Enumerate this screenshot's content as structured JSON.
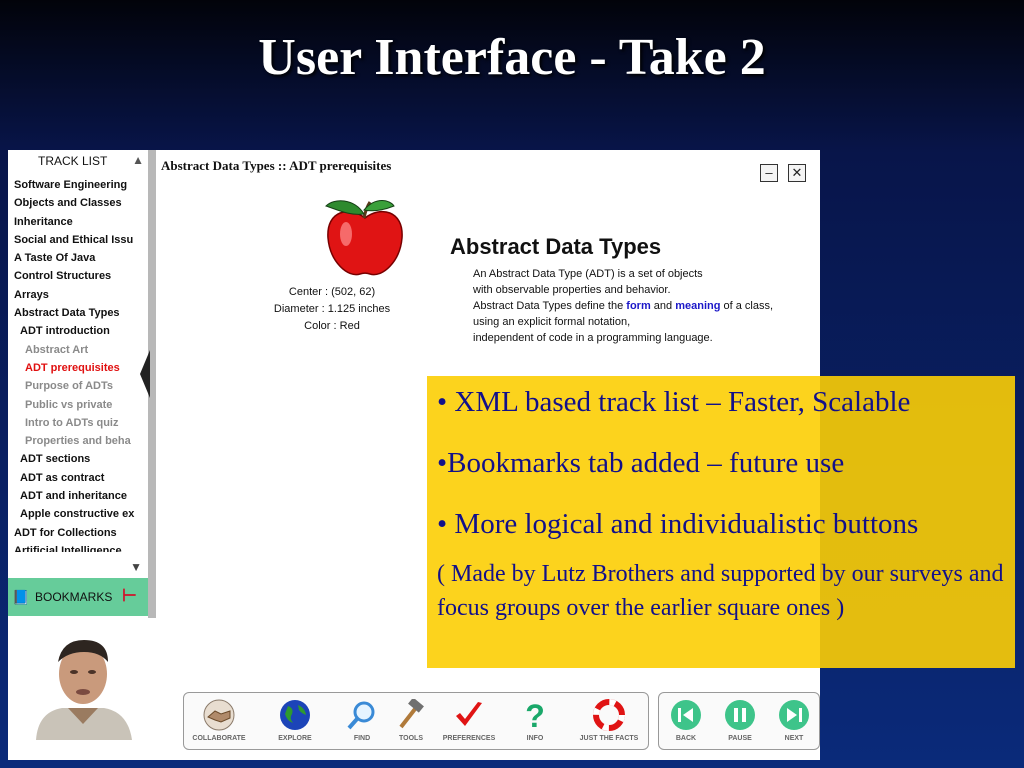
{
  "slide": {
    "title": "User Interface - Take 2"
  },
  "track_panel": {
    "header": "TRACK LIST",
    "items": [
      {
        "label": "Software Engineering",
        "level": 0,
        "active": false
      },
      {
        "label": "Objects and Classes",
        "level": 0,
        "active": false
      },
      {
        "label": "Inheritance",
        "level": 0,
        "active": false
      },
      {
        "label": "Social and Ethical Issu",
        "level": 0,
        "active": false
      },
      {
        "label": "A Taste Of Java",
        "level": 0,
        "active": false
      },
      {
        "label": "Control Structures",
        "level": 0,
        "active": false
      },
      {
        "label": "Arrays",
        "level": 0,
        "active": false
      },
      {
        "label": "Abstract Data Types",
        "level": 0,
        "active": false
      },
      {
        "label": "ADT introduction",
        "level": 1,
        "active": false
      },
      {
        "label": "Abstract Art",
        "level": 2,
        "active": false
      },
      {
        "label": "ADT prerequisites",
        "level": 2,
        "active": true
      },
      {
        "label": "Purpose of ADTs",
        "level": 2,
        "active": false
      },
      {
        "label": "Public vs private",
        "level": 2,
        "active": false
      },
      {
        "label": "Intro to ADTs quiz",
        "level": 2,
        "active": false
      },
      {
        "label": "Properties and beha",
        "level": 2,
        "active": false
      },
      {
        "label": "ADT sections",
        "level": 1,
        "active": false
      },
      {
        "label": "ADT as contract",
        "level": 1,
        "active": false
      },
      {
        "label": "ADT and inheritance",
        "level": 1,
        "active": false
      },
      {
        "label": "Apple constructive ex",
        "level": 1,
        "active": false
      },
      {
        "label": "ADT for Collections",
        "level": 0,
        "active": false
      },
      {
        "label": "Artificial Intelligence",
        "level": 0,
        "active": false
      }
    ],
    "bookmarks_label": "BOOKMARKS"
  },
  "content": {
    "breadcrumb": "Abstract Data Types :: ADT prerequisites",
    "minimize_glyph": "–",
    "close_glyph": "✕",
    "apple_info": {
      "center": "Center : (502, 62)",
      "diameter": "Diameter : 1.125 inches",
      "color": "Color : Red"
    },
    "heading": "Abstract Data Types",
    "para": {
      "line1": "An Abstract Data Type (ADT) is a set of objects",
      "line2": "with observable properties and behavior.",
      "line3_pre": "Abstract Data Types define the ",
      "kw_form": "form",
      "and": " and ",
      "kw_meaning": "meaning",
      "line3_post": " of a class,",
      "line4": "using an explicit formal notation,",
      "line5": "independent of code in a programming language."
    }
  },
  "callout": {
    "bullet1": "• XML based track list – Faster, Scalable",
    "bullet2": "•Bookmarks tab added – future use",
    "bullet3": "• More logical and individualistic buttons",
    "note": "( Made by Lutz Brothers and supported by our surveys and focus groups over the earlier square ones )"
  },
  "toolbar": {
    "collaborate": "COLLABORATE",
    "explore": "EXPLORE",
    "find": "FIND",
    "tools": "TOOLS",
    "preferences": "PREFERENCES",
    "info": "INFO",
    "just_the_facts": "JUST THE FACTS"
  },
  "nav": {
    "back": "BACK",
    "pause": "PAUSE",
    "next": "NEXT"
  },
  "colors": {
    "accent_green": "#66cc9a",
    "callout_yellow": "#fcce04",
    "callout_text": "#12108a",
    "active_item": "#e01010",
    "keyword_blue": "#1c18c8"
  }
}
